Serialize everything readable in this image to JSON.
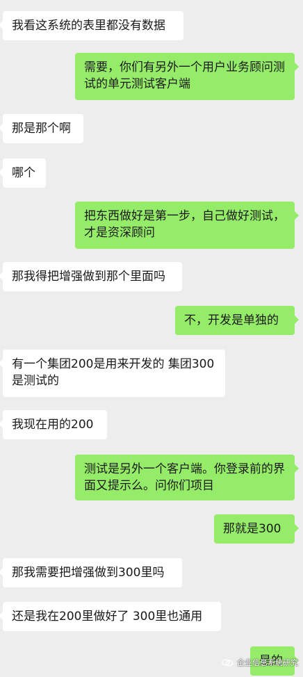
{
  "messages": [
    {
      "side": "left",
      "text": "我看这系统的表里都没有数据"
    },
    {
      "side": "right",
      "text": "需要，你们有另外一个用户业务顾问测试的单元测试客户端"
    },
    {
      "side": "left",
      "text": "那是那个啊"
    },
    {
      "side": "left",
      "text": "哪个"
    },
    {
      "side": "right",
      "text": "把东西做好是第一步，自己做好测试，才是资深顾问"
    },
    {
      "side": "left",
      "text": "那我得把增强做到那个里面吗"
    },
    {
      "side": "right",
      "text": "不，开发是单独的"
    },
    {
      "side": "left",
      "text": "有一个集团200是用来开发的 集团300是测试的"
    },
    {
      "side": "left",
      "text": "我现在用的200"
    },
    {
      "side": "right",
      "text": "测试是另外一个客户端。你登录前的界面又提示么。问你们项目"
    },
    {
      "side": "right",
      "text": "那就是300"
    },
    {
      "side": "left",
      "text": "那我需要把增强做到300里吗"
    },
    {
      "side": "left",
      "text": "还是我在200里做好了 300里也通用"
    },
    {
      "side": "right",
      "text": "是的"
    }
  ],
  "watermark": {
    "icon": "wechat-official-account-icon",
    "text": "企业信息系统研究"
  }
}
